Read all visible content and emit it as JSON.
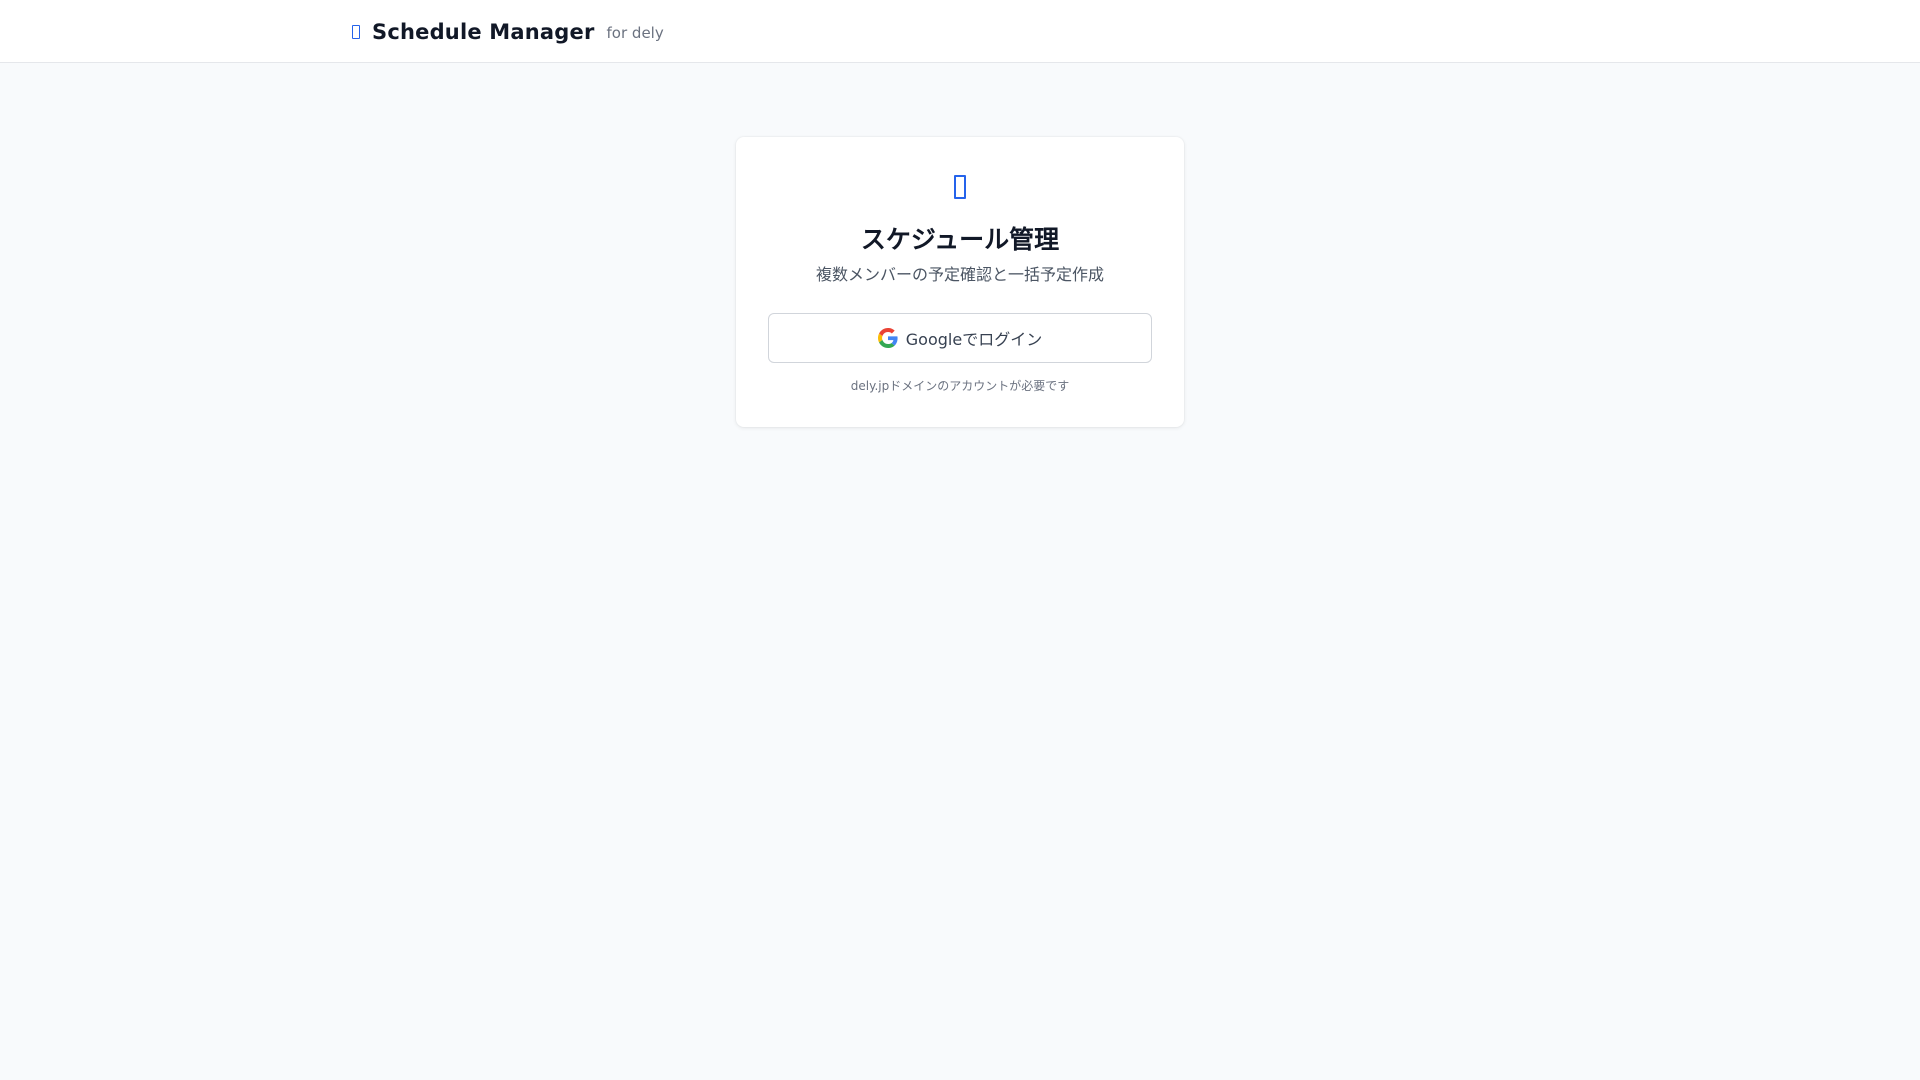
{
  "header": {
    "icon": "calendar-icon",
    "title": "Schedule Manager",
    "subtitle": "for dely"
  },
  "login_card": {
    "icon": "calendar-icon",
    "title": "スケジュール管理",
    "subtitle": "複数メンバーの予定確認と一括予定作成",
    "button": {
      "icon": "google-icon",
      "label": "Googleでログイン"
    },
    "note": "dely.jpドメインのアカウントが必要です"
  },
  "colors": {
    "accent": "#2563eb",
    "background": "#f8fafc",
    "card": "#ffffff",
    "text": "#111827",
    "muted": "#6b7280"
  }
}
